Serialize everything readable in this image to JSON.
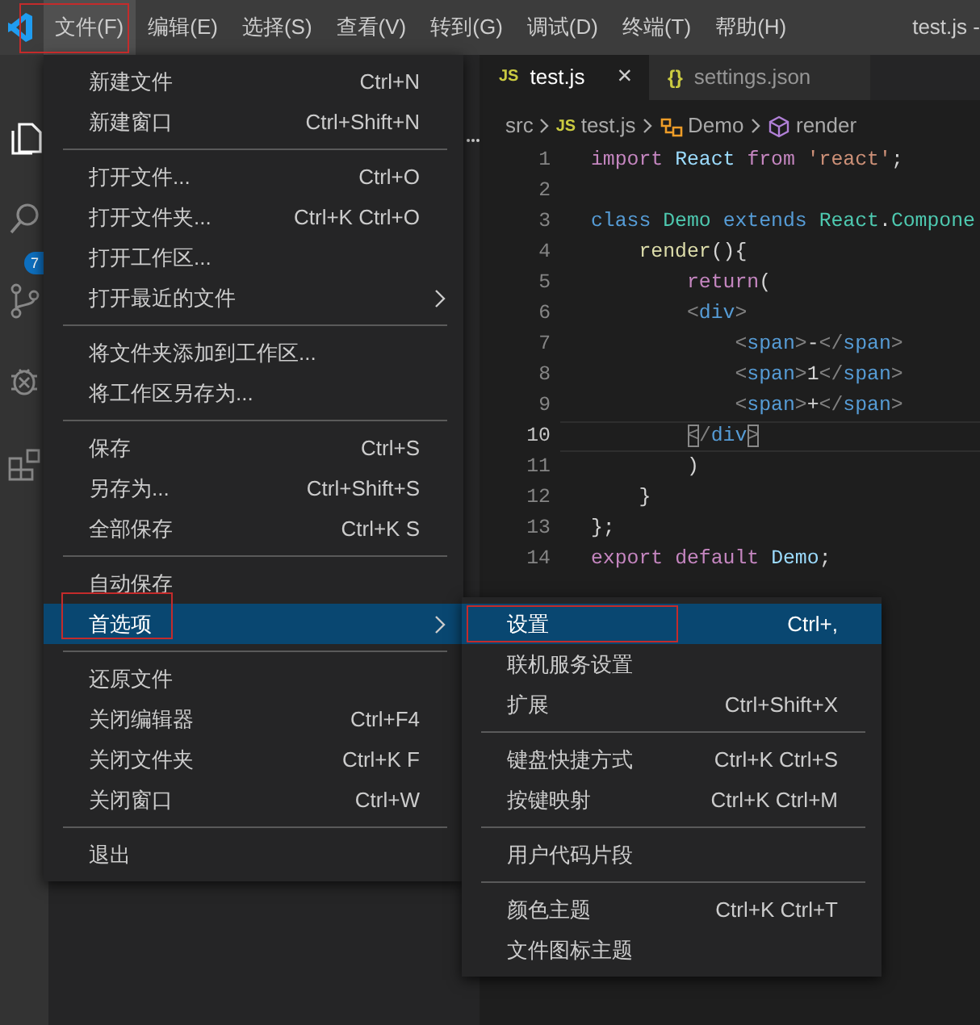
{
  "title_bar": {
    "menus": [
      {
        "label": "文件(F)",
        "selected": true,
        "annotated": true
      },
      {
        "label": "编辑(E)",
        "selected": false,
        "annotated": false
      },
      {
        "label": "选择(S)",
        "selected": false,
        "annotated": false
      },
      {
        "label": "查看(V)",
        "selected": false,
        "annotated": false
      },
      {
        "label": "转到(G)",
        "selected": false,
        "annotated": false
      },
      {
        "label": "调试(D)",
        "selected": false,
        "annotated": false
      },
      {
        "label": "终端(T)",
        "selected": false,
        "annotated": false
      },
      {
        "label": "帮助(H)",
        "selected": false,
        "annotated": false
      }
    ],
    "title": "test.js -"
  },
  "activity_bar": {
    "scm_badge": "7"
  },
  "tabs": [
    {
      "icon_text": "JS",
      "kind": "js",
      "label": "test.js",
      "selected": true,
      "close": "×"
    },
    {
      "icon_text": "{}",
      "kind": "json",
      "label": "settings.json",
      "selected": false
    }
  ],
  "breadcrumbs": [
    {
      "label": "src",
      "kind": "folder"
    },
    {
      "label": "test.js",
      "kind": "js",
      "icon_text": "JS"
    },
    {
      "label": "Demo",
      "kind": "class"
    },
    {
      "label": "render",
      "kind": "method"
    }
  ],
  "code": [
    {
      "number": "1",
      "current": false,
      "tokens": [
        {
          "t": "import ",
          "kind": "kw"
        },
        {
          "t": "React ",
          "kind": "var"
        },
        {
          "t": "from ",
          "kind": "kw"
        },
        {
          "t": "'react'",
          "kind": "str"
        },
        {
          "t": ";",
          "kind": "punc"
        }
      ]
    },
    {
      "number": "2",
      "current": false
    },
    {
      "number": "3",
      "current": false,
      "tokens": [
        {
          "t": "class ",
          "kind": "storage"
        },
        {
          "t": "Demo ",
          "kind": "cls"
        },
        {
          "t": "extends ",
          "kind": "storage"
        },
        {
          "t": "React",
          "kind": "cls"
        },
        {
          "t": ".",
          "kind": "punc"
        },
        {
          "t": "Compone",
          "kind": "cls"
        }
      ]
    },
    {
      "number": "4",
      "current": false,
      "tokens": [
        {
          "t": "    render",
          "kind": "fn"
        },
        {
          "t": "(){",
          "kind": "punc"
        }
      ]
    },
    {
      "number": "5",
      "current": false,
      "tokens": [
        {
          "t": "        return",
          "kind": "kw"
        },
        {
          "t": "(",
          "kind": "punc"
        }
      ]
    },
    {
      "number": "6",
      "current": false,
      "tokens": [
        {
          "t": "        <",
          "kind": "bracket"
        },
        {
          "t": "div",
          "kind": "tag"
        },
        {
          "t": ">",
          "kind": "bracket"
        }
      ]
    },
    {
      "number": "7",
      "current": false,
      "tokens": [
        {
          "t": "            <",
          "kind": "bracket"
        },
        {
          "t": "span",
          "kind": "tag"
        },
        {
          "t": ">",
          "kind": "bracket"
        },
        {
          "t": "-",
          "kind": "punc"
        },
        {
          "t": "</",
          "kind": "bracket"
        },
        {
          "t": "span",
          "kind": "tag"
        },
        {
          "t": ">",
          "kind": "bracket"
        }
      ]
    },
    {
      "number": "8",
      "current": false,
      "tokens": [
        {
          "t": "            <",
          "kind": "bracket"
        },
        {
          "t": "span",
          "kind": "tag"
        },
        {
          "t": ">",
          "kind": "bracket"
        },
        {
          "t": "1",
          "kind": "punc"
        },
        {
          "t": "</",
          "kind": "bracket"
        },
        {
          "t": "span",
          "kind": "tag"
        },
        {
          "t": ">",
          "kind": "bracket"
        }
      ]
    },
    {
      "number": "9",
      "current": false,
      "tokens": [
        {
          "t": "            <",
          "kind": "bracket"
        },
        {
          "t": "span",
          "kind": "tag"
        },
        {
          "t": ">",
          "kind": "bracket"
        },
        {
          "t": "+",
          "kind": "punc"
        },
        {
          "t": "</",
          "kind": "bracket"
        },
        {
          "t": "span",
          "kind": "tag"
        },
        {
          "t": ">",
          "kind": "bracket"
        }
      ]
    },
    {
      "number": "10",
      "current": true,
      "tokens": [
        {
          "t": "        <",
          "kind": "bracket",
          "matched": true
        },
        {
          "t": "/",
          "kind": "bracket"
        },
        {
          "t": "div",
          "kind": "tag"
        },
        {
          "t": ">",
          "kind": "bracket",
          "matched": true
        }
      ]
    },
    {
      "number": "11",
      "current": false,
      "tokens": [
        {
          "t": "        )",
          "kind": "punc"
        }
      ]
    },
    {
      "number": "12",
      "current": false,
      "tokens": [
        {
          "t": "    }",
          "kind": "punc"
        }
      ]
    },
    {
      "number": "13",
      "current": false,
      "tokens": [
        {
          "t": "};",
          "kind": "punc"
        }
      ]
    },
    {
      "number": "14",
      "current": false,
      "tokens": [
        {
          "t": "export ",
          "kind": "kw"
        },
        {
          "t": "default ",
          "kind": "kw"
        },
        {
          "t": "Demo",
          "kind": "var"
        },
        {
          "t": ";",
          "kind": "punc"
        }
      ]
    }
  ],
  "file_menu": {
    "groups": [
      [
        {
          "label": "新建文件",
          "shortcut": "Ctrl+N"
        },
        {
          "label": "新建窗口",
          "shortcut": "Ctrl+Shift+N"
        }
      ],
      [
        {
          "label": "打开文件...",
          "shortcut": "Ctrl+O"
        },
        {
          "label": "打开文件夹...",
          "shortcut": "Ctrl+K Ctrl+O"
        },
        {
          "label": "打开工作区..."
        },
        {
          "label": "打开最近的文件",
          "submenu": true
        }
      ],
      [
        {
          "label": "将文件夹添加到工作区..."
        },
        {
          "label": "将工作区另存为..."
        }
      ],
      [
        {
          "label": "保存",
          "shortcut": "Ctrl+S"
        },
        {
          "label": "另存为...",
          "shortcut": "Ctrl+Shift+S"
        },
        {
          "label": "全部保存",
          "shortcut": "Ctrl+K S"
        }
      ],
      [
        {
          "label": "自动保存"
        },
        {
          "label": "首选项",
          "submenu": true,
          "selected": true,
          "annotated": true
        }
      ],
      [
        {
          "label": "还原文件"
        },
        {
          "label": "关闭编辑器",
          "shortcut": "Ctrl+F4"
        },
        {
          "label": "关闭文件夹",
          "shortcut": "Ctrl+K F"
        },
        {
          "label": "关闭窗口",
          "shortcut": "Ctrl+W"
        }
      ],
      [
        {
          "label": "退出"
        }
      ]
    ]
  },
  "preferences_submenu": {
    "groups": [
      [
        {
          "label": "设置",
          "shortcut": "Ctrl+,",
          "selected": true,
          "annotated": true
        },
        {
          "label": "联机服务设置"
        },
        {
          "label": "扩展",
          "shortcut": "Ctrl+Shift+X"
        }
      ],
      [
        {
          "label": "键盘快捷方式",
          "shortcut": "Ctrl+K Ctrl+S"
        },
        {
          "label": "按键映射",
          "shortcut": "Ctrl+K Ctrl+M"
        }
      ],
      [
        {
          "label": "用户代码片段"
        }
      ],
      [
        {
          "label": "颜色主题",
          "shortcut": "Ctrl+K Ctrl+T"
        },
        {
          "label": "文件图标主题"
        }
      ]
    ]
  }
}
